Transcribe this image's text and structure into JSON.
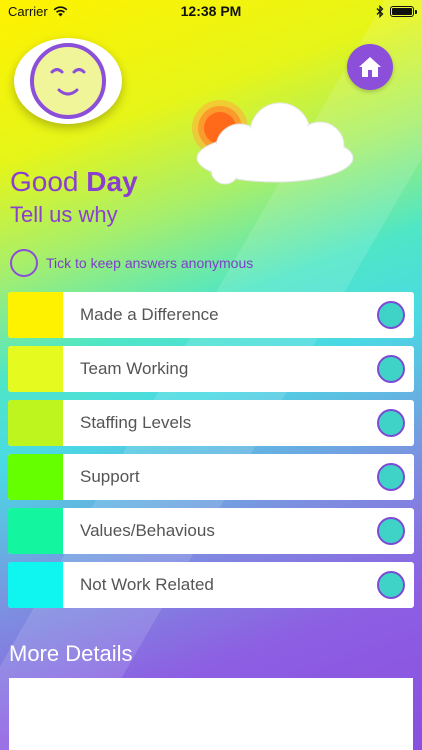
{
  "status_bar": {
    "carrier": "Carrier",
    "time": "12:38 PM"
  },
  "header": {
    "mood_icon": "smiley-face-icon",
    "home_icon": "home-icon",
    "weather_icon": "sun-behind-cloud-icon"
  },
  "title": {
    "prefix": "Good",
    "mood": "Day",
    "subtitle": "Tell us why"
  },
  "anonymous": {
    "label": "Tick to keep answers anonymous",
    "checked": false
  },
  "reasons": [
    {
      "label": "Made a Difference",
      "color": "#fff200"
    },
    {
      "label": "Team Working",
      "color": "#e5fa1e"
    },
    {
      "label": "Staffing Levels",
      "color": "#bff51e"
    },
    {
      "label": "Support",
      "color": "#66ff00"
    },
    {
      "label": "Values/Behavious",
      "color": "#14f5a0"
    },
    {
      "label": "Not Work Related",
      "color": "#0ff5f0"
    }
  ],
  "more_details": {
    "label": "More Details",
    "value": ""
  },
  "colors": {
    "accent_purple": "#8a3fd0",
    "check_fill": "#3fd3c8"
  }
}
